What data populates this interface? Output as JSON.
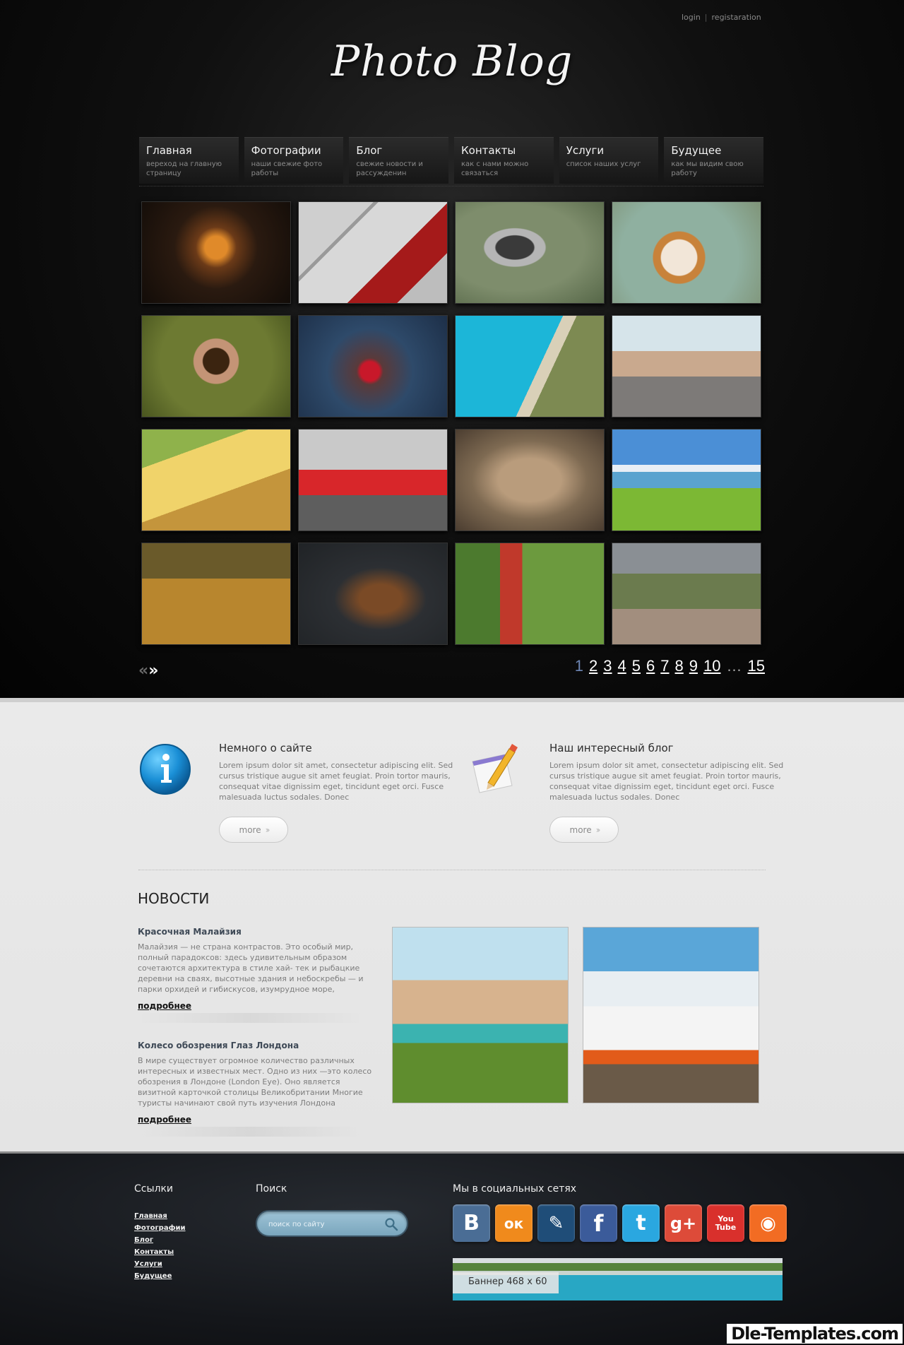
{
  "header": {
    "login": "login",
    "separator": "|",
    "register": "registaration",
    "logo": "Photo Blog"
  },
  "nav": [
    {
      "title": "Главная",
      "sub": "вереход на главную страницу"
    },
    {
      "title": "Фотографии",
      "sub": "наши свежие фото работы"
    },
    {
      "title": "Блог",
      "sub": "свежие новости и рассужденин"
    },
    {
      "title": "Контакты",
      "sub": "как с нами можно связаться"
    },
    {
      "title": "Услуги",
      "sub": "список наших услуг"
    },
    {
      "title": "Будущее",
      "sub": "как мы видим свою работу"
    }
  ],
  "gallery": [
    {
      "subject": "crystal ball on book"
    },
    {
      "subject": "youtube logo"
    },
    {
      "subject": "camera in grass"
    },
    {
      "subject": "cartoon dog"
    },
    {
      "subject": "woman love letters"
    },
    {
      "subject": "red flower bokeh"
    },
    {
      "subject": "blue bay aerial"
    },
    {
      "subject": "woman on pebbles"
    },
    {
      "subject": "cheese and wine"
    },
    {
      "subject": "red sports car"
    },
    {
      "subject": "cats close up"
    },
    {
      "subject": "green lake landscape"
    },
    {
      "subject": "bench with autumn leaves"
    },
    {
      "subject": "brown horse"
    },
    {
      "subject": "woman in forest"
    },
    {
      "subject": "city park aerial"
    }
  ],
  "pagination": {
    "prev": "«",
    "next": "»",
    "pages": [
      "1",
      "2",
      "3",
      "4",
      "5",
      "6",
      "7",
      "8",
      "9",
      "10"
    ],
    "dots": "…",
    "last": "15",
    "active": "1"
  },
  "about": [
    {
      "title": "Немного о сайте",
      "text": "Lorem ipsum dolor sit amet, consectetur adipiscing elit. Sed cursus tristique augue sit amet feugiat. Proin tortor mauris, consequat vitae dignissim eget, tincidunt eget orci. Fusce malesuada luctus sodales. Donec",
      "more": "more",
      "icon": "info-icon"
    },
    {
      "title": "Наш интересный блог",
      "text": "Lorem ipsum dolor sit amet, consectetur adipiscing elit. Sed cursus tristique augue sit amet feugiat. Proin tortor mauris, consequat vitae dignissim eget, tincidunt eget orci. Fusce malesuada luctus sodales. Donec",
      "more": "more",
      "icon": "notepad-pencil-icon"
    }
  ],
  "news": {
    "title": "НОВОСТИ",
    "items": [
      {
        "title": "Красочная Малайзия",
        "text": "Малайзия — не страна контрастов. Это особый мир, полный парадоксов: здесь удивительным образом сочетаются архитектура в стиле хай- тек и рыбацкие деревни на сваях, высотные здания и небоскребы — и парки орхидей и гибискусов, изумрудное море,",
        "more": "подробнее"
      },
      {
        "title": "Колесо обозрения Глаз Лондона",
        "text": "В мире существует огромное количество различных интересных и известных мест. Одно из них —это колесо обозрения в Лондоне (London Eye). Оно является визитной карточкой столицы Великобритании Многие туристы начинают свой путь изучения Лондона",
        "more": "подробнее"
      }
    ],
    "photos": [
      {
        "subject": "woman in turquoise bikini"
      },
      {
        "subject": "white car with glowing wheel"
      }
    ]
  },
  "footer": {
    "links_title": "Ссылки",
    "links": [
      "Главная",
      "Фотографии",
      "Блог",
      "Контакты",
      "Услуги",
      "Будущее"
    ],
    "search_title": "Поиск",
    "search_placeholder": "поиск по сайту",
    "social_title": "Мы в социальных сетях",
    "socials": [
      {
        "name": "vkontakte",
        "glyph": "B",
        "color": "#4a6d95"
      },
      {
        "name": "odnoklassniki",
        "glyph": "ок",
        "color": "#f08a1c"
      },
      {
        "name": "livejournal",
        "glyph": "✎",
        "color": "#1f4d78"
      },
      {
        "name": "facebook",
        "glyph": "f",
        "color": "#3b5b9a"
      },
      {
        "name": "twitter",
        "glyph": "t",
        "color": "#2aa7e0"
      },
      {
        "name": "google-plus",
        "glyph": "g+",
        "color": "#dd4b39"
      },
      {
        "name": "youtube",
        "glyph": "You Tube",
        "color": "#d9302c"
      },
      {
        "name": "rss",
        "glyph": "◉",
        "color": "#f26c23"
      }
    ],
    "banner": "Баннер 468 x 60"
  },
  "watermark": "Dle-Templates.com"
}
